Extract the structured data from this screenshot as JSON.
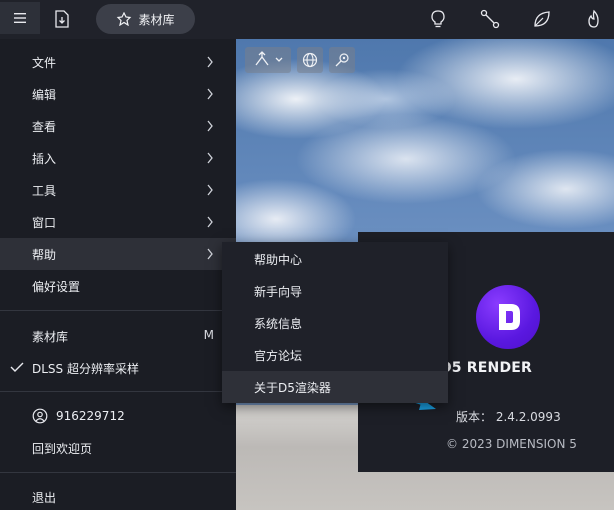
{
  "toolbar": {
    "assets_label": "素材库",
    "icons": [
      "menu-icon",
      "import-icon",
      "assets-icon",
      "lightbulb-icon",
      "path-icon",
      "leaf-icon",
      "fire-icon"
    ]
  },
  "main_menu": {
    "items": [
      {
        "label": "文件",
        "has_submenu": true
      },
      {
        "label": "编辑",
        "has_submenu": true
      },
      {
        "label": "查看",
        "has_submenu": true
      },
      {
        "label": "插入",
        "has_submenu": true
      },
      {
        "label": "工具",
        "has_submenu": true
      },
      {
        "label": "窗口",
        "has_submenu": true
      },
      {
        "label": "帮助",
        "has_submenu": true,
        "active": true
      },
      {
        "label": "偏好设置"
      }
    ],
    "assets": {
      "label": "素材库",
      "shortcut": "M"
    },
    "dlss": {
      "label": "DLSS 超分辨率采样",
      "checked": true
    },
    "user": {
      "label": "916229712"
    },
    "welcome": {
      "label": "回到欢迎页"
    },
    "exit": {
      "label": "退出"
    }
  },
  "help_submenu": {
    "items": [
      {
        "label": "帮助中心"
      },
      {
        "label": "新手向导"
      },
      {
        "label": "系统信息"
      },
      {
        "label": "官方论坛"
      },
      {
        "label": "关于D5渲染器",
        "active": true
      }
    ]
  },
  "about": {
    "product_name": "D5 RENDER",
    "version_text": "版本： 2.4.2.0993",
    "copyright": "© 2023 DIMENSION 5"
  },
  "colors": {
    "accent": "#6a24f0",
    "annotation_arrow": "#1aa3e8",
    "menu_bg": "#1b1d24"
  }
}
